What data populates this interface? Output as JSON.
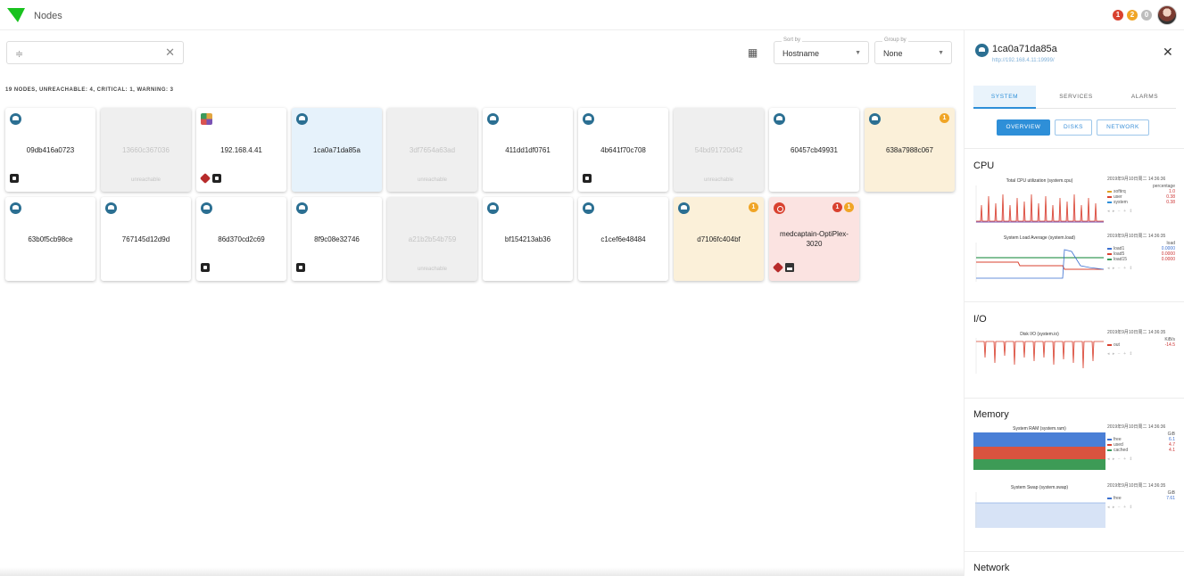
{
  "app": {
    "title": "Nodes"
  },
  "header": {
    "alarms": [
      {
        "name": "critical-alarm-indicator",
        "count": "1",
        "color": "#d9412f"
      },
      {
        "name": "warning-alarm-indicator",
        "count": "2",
        "color": "#f0a526"
      },
      {
        "name": "info-alarm-indicator",
        "count": "0",
        "color": "#bdbdbd"
      }
    ]
  },
  "toolbar": {
    "search_value": "",
    "sort": {
      "label": "Sort by",
      "value": "Hostname"
    },
    "group": {
      "label": "Group by",
      "value": "None"
    }
  },
  "summary": "19 NODES, UNREACHABLE: 4, CRITICAL: 1, WARNING: 3",
  "nodes": [
    {
      "name": "09db416a0723",
      "state": "normal",
      "os": "cloud",
      "badges": [
        "dark"
      ]
    },
    {
      "name": "13660c367036",
      "state": "unreachable",
      "status": "unreachable"
    },
    {
      "name": "192.168.4.41",
      "state": "normal",
      "os": "multi",
      "badges": [
        "cube",
        "dark"
      ]
    },
    {
      "name": "1ca0a71da85a",
      "state": "selected",
      "os": "cloud",
      "badges": []
    },
    {
      "name": "3df7654a63ad",
      "state": "unreachable",
      "status": "unreachable"
    },
    {
      "name": "411dd1df0761",
      "state": "normal",
      "os": "cloud",
      "badges": []
    },
    {
      "name": "4b641f70c708",
      "state": "normal",
      "os": "cloud",
      "badges": [
        "dark"
      ]
    },
    {
      "name": "54bd91720d42",
      "state": "unreachable",
      "status": "unreachable"
    },
    {
      "name": "60457cb49931",
      "state": "normal",
      "os": "cloud",
      "badges": []
    },
    {
      "name": "638a7988c067",
      "state": "warning",
      "os": "cloud",
      "badges": [],
      "alarms": [
        {
          "count": "1",
          "color": "#f0a526"
        }
      ]
    },
    {
      "name": "63b0f5cb98ce",
      "state": "normal",
      "os": "cloud",
      "badges": []
    },
    {
      "name": "767145d12d9d",
      "state": "normal",
      "os": "cloud",
      "badges": []
    },
    {
      "name": "86d370cd2c69",
      "state": "normal",
      "os": "cloud",
      "badges": [
        "dark"
      ]
    },
    {
      "name": "8f9c08e32746",
      "state": "normal",
      "os": "cloud",
      "badges": [
        "dark"
      ]
    },
    {
      "name": "a21b2b54b759",
      "state": "unreachable",
      "status": "unreachable"
    },
    {
      "name": "bf154213ab36",
      "state": "normal",
      "os": "cloud",
      "badges": []
    },
    {
      "name": "c1cef6e48484",
      "state": "normal",
      "os": "cloud",
      "badges": []
    },
    {
      "name": "d7106fc404bf",
      "state": "warning",
      "os": "cloud",
      "badges": [],
      "alarms": [
        {
          "count": "1",
          "color": "#f0a526"
        }
      ]
    },
    {
      "name": "medcaptain-OptiPlex-3020",
      "state": "critical",
      "os": "red",
      "badges": [
        "cube",
        "printer"
      ],
      "alarms": [
        {
          "count": "1",
          "color": "#d9412f"
        },
        {
          "count": "1",
          "color": "#f0a526"
        }
      ]
    }
  ],
  "panel": {
    "title": "1ca0a71da85a",
    "url": "http://192.168.4.11:19999/",
    "tabs": [
      "SYSTEM",
      "SERVICES",
      "ALARMS"
    ],
    "subtabs": [
      "OVERVIEW",
      "DISKS",
      "NETWORK"
    ],
    "sections": {
      "cpu": "CPU",
      "io": "I/O",
      "memory": "Memory",
      "network": "Network"
    },
    "charts": {
      "cpu": {
        "title": "Total CPU utilization (system.cpu)",
        "time": "2019年9月10日周二 14:36:36",
        "unit": "percentage",
        "legend": [
          {
            "label": "softirq",
            "value": "1.0",
            "color": "#e0a020"
          },
          {
            "label": "user",
            "value": "0.38",
            "color": "#d9412f"
          },
          {
            "label": "system",
            "value": "0.38",
            "color": "#2e8fd8"
          }
        ]
      },
      "load": {
        "title": "System Load Average (system.load)",
        "time": "2019年9月10日周二 14:36:35",
        "unit": "load",
        "legend": [
          {
            "label": "load1",
            "value": "0.0000",
            "color": "#3a6fd0"
          },
          {
            "label": "load5",
            "value": "0.0000",
            "color": "#d9412f"
          },
          {
            "label": "load15",
            "value": "0.0000",
            "color": "#3b9a5b"
          }
        ]
      },
      "disk": {
        "title": "Disk I/O (system.io)",
        "time": "2019年9月10日周二 14:36:35",
        "unit": "KiB/s",
        "legend": [
          {
            "label": "out",
            "value": "-14.5",
            "color": "#d9412f"
          }
        ]
      },
      "ram": {
        "title": "System RAM (system.ram)",
        "time": "2019年9月10日周二 14:36:36",
        "unit": "GiB",
        "legend": [
          {
            "label": "free",
            "value": "6.1",
            "color": "#3a6fd0"
          },
          {
            "label": "used",
            "value": "4.7",
            "color": "#d9412f"
          },
          {
            "label": "cached",
            "value": "4.1",
            "color": "#3b9a5b"
          }
        ]
      },
      "swap": {
        "title": "System Swap (system.swap)",
        "time": "2019年9月10日周二 14:36:35",
        "unit": "GiB",
        "legend": [
          {
            "label": "free",
            "value": "7.61",
            "color": "#3a6fd0"
          }
        ]
      }
    }
  }
}
